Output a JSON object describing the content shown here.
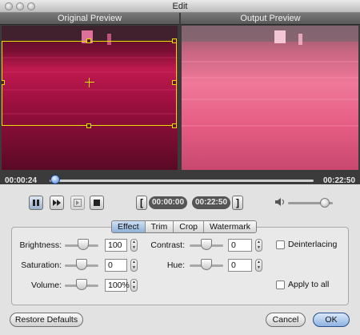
{
  "window": {
    "title": "Edit"
  },
  "preview": {
    "original_label": "Original Preview",
    "output_label": "Output Preview"
  },
  "timeline": {
    "current_time": "00:00:24",
    "end_time": "00:22:50",
    "progress": 0.02
  },
  "playback": {
    "play_pause_icon": "pause-icon",
    "forward_icon": "fast-forward-icon",
    "frame_icon": "next-frame-icon",
    "stop_icon": "stop-icon",
    "trim_start": "00:00:00",
    "trim_end": "00:22:50",
    "volume_level": 0.82
  },
  "tabs": [
    "Effect",
    "Trim",
    "Crop",
    "Watermark"
  ],
  "effect": {
    "brightness": {
      "label": "Brightness:",
      "value": "100",
      "level": 0.55
    },
    "saturation": {
      "label": "Saturation:",
      "value": "0",
      "level": 0.5
    },
    "volume": {
      "label": "Volume:",
      "value": "100%",
      "level": 0.5
    },
    "contrast": {
      "label": "Contrast:",
      "value": "0",
      "level": 0.5
    },
    "hue": {
      "label": "Hue:",
      "value": "0",
      "level": 0.5
    },
    "deinterlacing": {
      "label": "Deinterlacing",
      "checked": false
    },
    "apply_all": {
      "label": "Apply to all",
      "checked": false
    }
  },
  "buttons": {
    "restore": "Restore Defaults",
    "cancel": "Cancel",
    "ok": "OK"
  },
  "colors": {
    "crop_box": "#e8e000",
    "preview_red": "#9b1040",
    "output_pink": "#e86a8c"
  }
}
